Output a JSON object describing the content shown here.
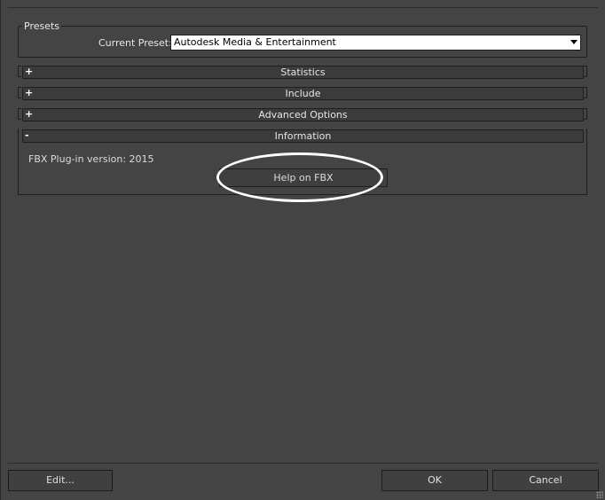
{
  "presets": {
    "title": "Presets",
    "current_preset_label": "Current Preset:",
    "current_preset_value": "Autodesk Media & Entertainment"
  },
  "rollouts": [
    {
      "label": "Statistics",
      "state": "+"
    },
    {
      "label": "Include",
      "state": "+"
    },
    {
      "label": "Advanced Options",
      "state": "+"
    },
    {
      "label": "Information",
      "state": "-"
    }
  ],
  "information": {
    "version_text": "FBX Plug-in version: 2015",
    "help_button": "Help on FBX"
  },
  "footer": {
    "edit": "Edit...",
    "ok": "OK",
    "cancel": "Cancel"
  },
  "colors": {
    "background": "#444444",
    "highlight": "#ffffff"
  },
  "icons": {
    "dropdown": "chevron-down-icon",
    "resize": "resize-grip-icon"
  }
}
